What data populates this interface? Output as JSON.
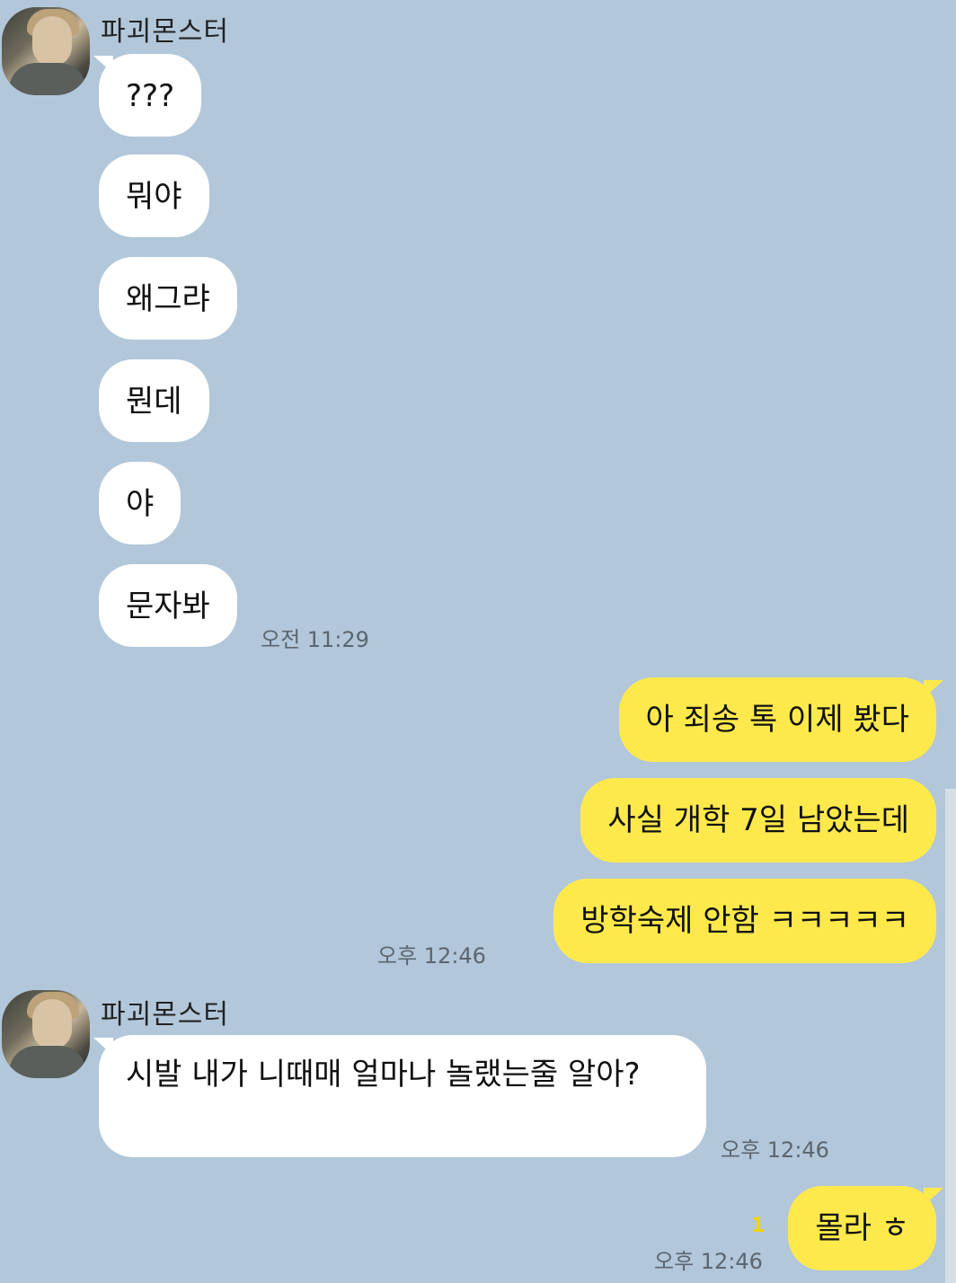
{
  "chat": {
    "friend_name": "파괴몬스터",
    "messages": [
      {
        "from": "friend",
        "text": "???"
      },
      {
        "from": "friend",
        "text": "뭐야"
      },
      {
        "from": "friend",
        "text": "왜그랴"
      },
      {
        "from": "friend",
        "text": "뭔데"
      },
      {
        "from": "friend",
        "text": "야"
      },
      {
        "from": "friend",
        "text": "문자봐",
        "time": "오전 11:29"
      },
      {
        "from": "me",
        "text": "아 죄송 톡 이제 봤다"
      },
      {
        "from": "me",
        "text": "사실 개학 7일 남았는데"
      },
      {
        "from": "me",
        "text": "방학숙제 안함 ㅋㅋㅋㅋㅋ",
        "time": "오후 12:46"
      },
      {
        "from": "friend",
        "text": "시발 내가 니때매 얼마나 놀랬는줄 알아?",
        "time": "오후 12:46"
      },
      {
        "from": "me",
        "text": "몰라 ㅎ",
        "time": "오후 12:46",
        "unread": "1"
      }
    ]
  },
  "colors": {
    "background": "#b2c7da",
    "friend_bubble": "#ffffff",
    "my_bubble": "#fee94c",
    "unread": "#f5d300"
  }
}
